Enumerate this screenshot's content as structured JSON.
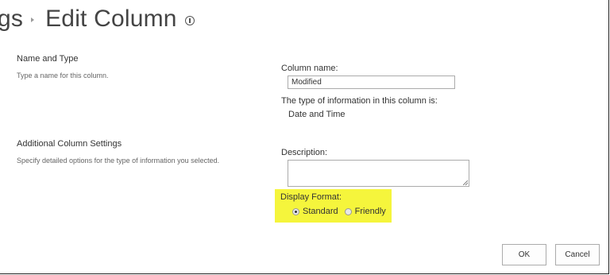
{
  "header": {
    "breadcrumb_prev": "gs",
    "title": "Edit Column"
  },
  "sections": {
    "name_type": {
      "heading": "Name and Type",
      "description": "Type a name for this column."
    },
    "additional": {
      "heading": "Additional Column Settings",
      "description": "Specify detailed options for the type of information you selected."
    }
  },
  "fields": {
    "column_name_label": "Column name:",
    "column_name_value": "Modified",
    "type_label": "The type of information in this column is:",
    "type_value": "Date and Time",
    "description_label": "Description:",
    "description_value": "",
    "display_format_label": "Display Format:",
    "display_format_options": [
      "Standard",
      "Friendly"
    ],
    "display_format_selected": "Standard"
  },
  "buttons": {
    "ok": "OK",
    "cancel": "Cancel"
  },
  "colors": {
    "highlight": "#f5f53c",
    "text": "#444444"
  }
}
